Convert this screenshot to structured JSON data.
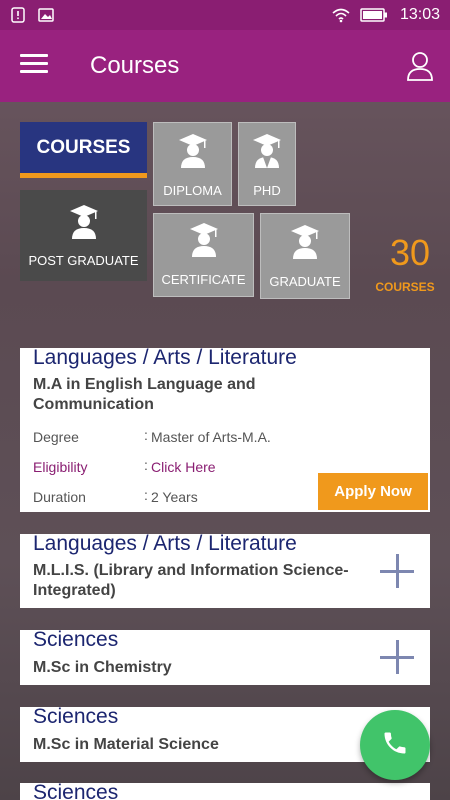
{
  "status_bar": {
    "time": "13:03"
  },
  "app_bar": {
    "title": "Courses"
  },
  "categories": {
    "active_tab": "COURSES",
    "tiles": [
      {
        "label": "DIPLOMA"
      },
      {
        "label": "PHD"
      },
      {
        "label": "POST GRADUATE"
      },
      {
        "label": "CERTIFICATE"
      },
      {
        "label": "GRADUATE"
      }
    ]
  },
  "course_count": {
    "number": "30",
    "label": "COURSES"
  },
  "courses": [
    {
      "category": "Languages / Arts / Literature",
      "name": "M.A in English Language and Communication",
      "expanded": true,
      "details": {
        "degree_label": "Degree",
        "degree_value": "Master of Arts-M.A.",
        "eligibility_label": "Eligibility",
        "eligibility_value": "Click Here",
        "duration_label": "Duration",
        "duration_value": "2 Years",
        "colon": ":",
        "apply_label": "Apply Now"
      }
    },
    {
      "category": "Languages / Arts / Literature",
      "name": "M.L.I.S. (Library and Information Science- Integrated)",
      "expanded": false
    },
    {
      "category": "Sciences",
      "name": "M.Sc in Chemistry",
      "expanded": false
    },
    {
      "category": "Sciences",
      "name": "M.Sc in Material Science",
      "expanded": false
    },
    {
      "category": "Sciences",
      "name": "",
      "expanded": false
    }
  ],
  "colors": {
    "app_bar": "#99227f",
    "status_bar": "#8a1e72",
    "accent": "#f0991c",
    "navy": "#283580",
    "fab": "#41c46a"
  },
  "icons": [
    "menu-icon",
    "profile-icon",
    "graduation-cap-icon",
    "plus-icon",
    "phone-icon"
  ]
}
